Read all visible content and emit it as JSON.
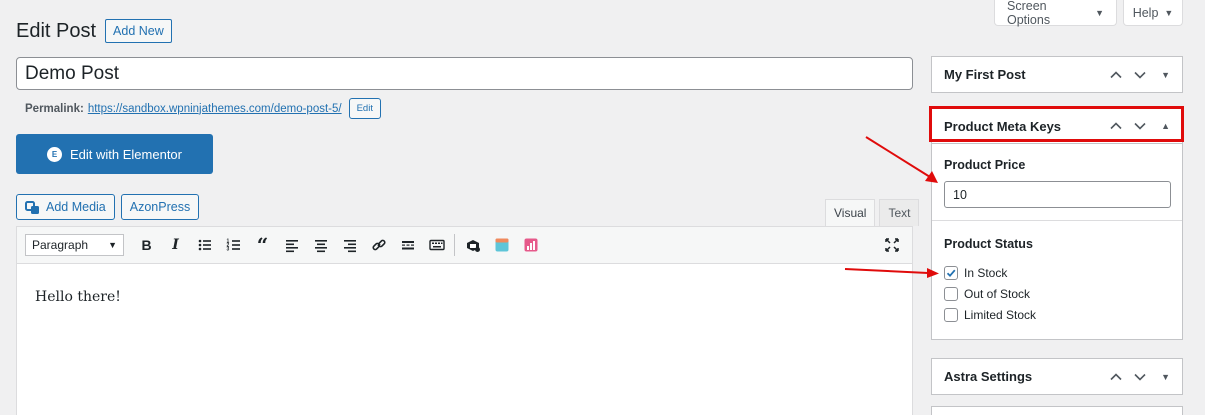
{
  "screen_meta": {
    "screen_options": "Screen Options",
    "help": "Help"
  },
  "header": {
    "title": "Edit Post",
    "add_new": "Add New"
  },
  "post": {
    "title": "Demo Post",
    "permalink_label": "Permalink:",
    "permalink_url": "https://sandbox.wpninjathemes.com/demo-post-5/",
    "permalink_edit": "Edit"
  },
  "elementor": {
    "label": "Edit with Elementor",
    "icon": "elementor-icon"
  },
  "media": {
    "add_media": "Add Media",
    "azonpress": "AzonPress"
  },
  "editor": {
    "tabs": [
      "Visual",
      "Text"
    ],
    "format": "Paragraph",
    "content": "Hello there!"
  },
  "sidebar": {
    "box1_title": "My First Post",
    "box2_title": "Product Meta Keys",
    "price_label": "Product Price",
    "price_value": "10",
    "status_label": "Product Status",
    "status_options": [
      {
        "label": "In Stock",
        "checked": true
      },
      {
        "label": "Out of Stock",
        "checked": false
      },
      {
        "label": "Limited Stock",
        "checked": false
      }
    ],
    "box3_title": "Astra Settings"
  },
  "colors": {
    "accent": "#2271b1",
    "highlight": "#e00b0b"
  }
}
